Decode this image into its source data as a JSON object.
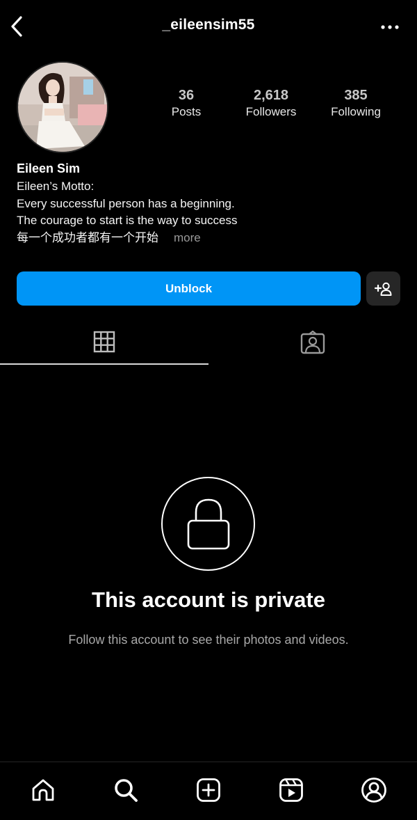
{
  "header": {
    "username": "_eileensim55"
  },
  "stats": [
    {
      "value": "36",
      "label": "Posts"
    },
    {
      "value": "2,618",
      "label": "Followers"
    },
    {
      "value": "385",
      "label": "Following"
    }
  ],
  "bio": {
    "name": "Eileen Sim",
    "lines": [
      "Eileen’s Motto:",
      "Every successful person has a beginning.",
      "The courage to start is the way to success",
      "每一个成功者都有一个开始"
    ],
    "more_label": "more"
  },
  "actions": {
    "unblock_label": "Unblock"
  },
  "private": {
    "title": "This account is private",
    "subtitle": "Follow this account to see their photos and videos."
  },
  "colors": {
    "accent": "#0095f6",
    "background": "#000000",
    "secondary_button": "#262626",
    "muted_text": "#a8a8a8"
  },
  "icons": {
    "back": "chevron-left-icon",
    "more": "ellipsis-icon",
    "add_user": "add-user-icon",
    "grid": "grid-icon",
    "tagged": "tagged-icon",
    "lock": "lock-icon",
    "home": "home-icon",
    "search": "search-icon",
    "create": "create-icon",
    "reels": "reels-icon",
    "profile": "profile-icon"
  }
}
